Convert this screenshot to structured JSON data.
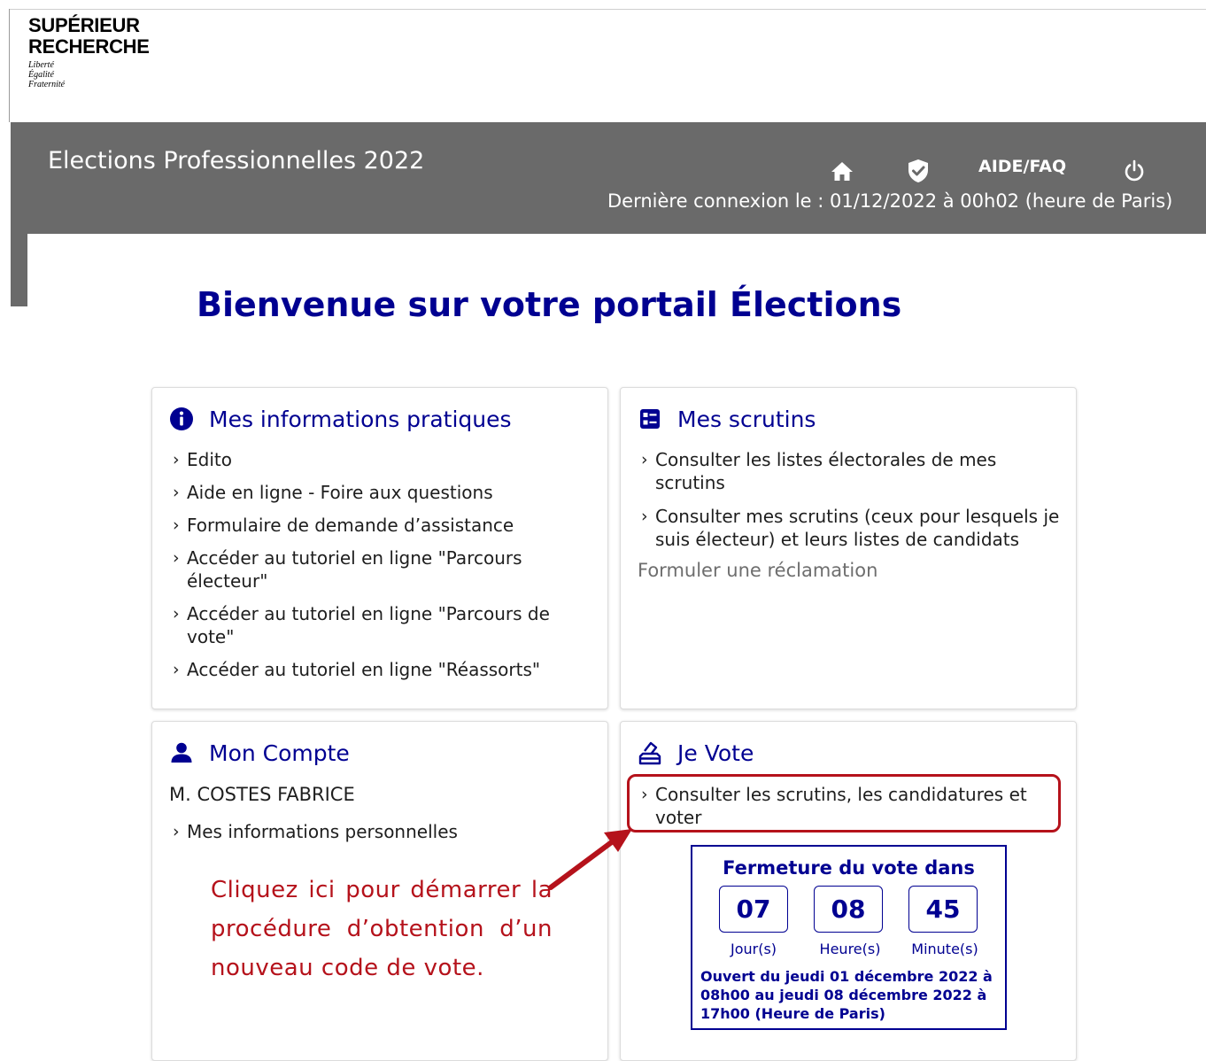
{
  "logo": {
    "line1": "SUPÉRIEUR",
    "line2": "RECHERCHE",
    "motto": [
      "Liberté",
      "Égalité",
      "Fraternité"
    ]
  },
  "header": {
    "title": "Elections Professionnelles 2022",
    "icons": [
      "home-icon",
      "shield-check-icon",
      "power-icon"
    ],
    "aide_label": "AIDE/FAQ",
    "last_login": "Dernière connexion le : 01/12/2022 à 00h02 (heure de Paris)"
  },
  "welcome": "Bienvenue sur votre portail Élections",
  "cards": {
    "info": {
      "icon": "info-icon",
      "title": "Mes informations pratiques",
      "links": [
        "Edito",
        "Aide en ligne - Foire aux questions",
        "Formulaire de demande d’assistance",
        "Accéder au tutoriel en ligne \"Parcours électeur\"",
        "Accéder au tutoriel en ligne \"Parcours de vote\"",
        "Accéder au tutoriel en ligne \"Réassorts\""
      ]
    },
    "scrutins": {
      "icon": "ballot-list-icon",
      "title": "Mes scrutins",
      "links": [
        "Consulter les listes électorales de mes scrutins",
        "Consulter mes scrutins (ceux pour lesquels je suis électeur) et leurs listes de candidats"
      ],
      "reclamation": "Formuler une réclamation"
    },
    "compte": {
      "icon": "user-icon",
      "title": "Mon Compte",
      "user_name": "M. COSTES FABRICE",
      "links": [
        "Mes informations personnelles"
      ]
    },
    "vote": {
      "icon": "vote-icon",
      "title": "Je Vote",
      "links": [
        "Consulter les scrutins, les candidatures et voter"
      ]
    }
  },
  "countdown": {
    "title": "Fermeture du vote dans",
    "days": "07",
    "hours": "08",
    "minutes": "45",
    "days_label": "Jour(s)",
    "hours_label": "Heure(s)",
    "minutes_label": "Minute(s)",
    "open_text": "Ouvert du jeudi 01 décembre 2022 à 08h00 au jeudi 08 décembre 2022 à 17h00 (Heure de Paris)"
  },
  "annotation": {
    "text": "Cliquez ici pour démarrer la procédure d’obtention d’un nouveau code de vote.",
    "color": "#b5121b"
  },
  "colors": {
    "brand_blue": "#000091",
    "header_gray": "#6a6a6a",
    "annotation_red": "#b5121b"
  }
}
